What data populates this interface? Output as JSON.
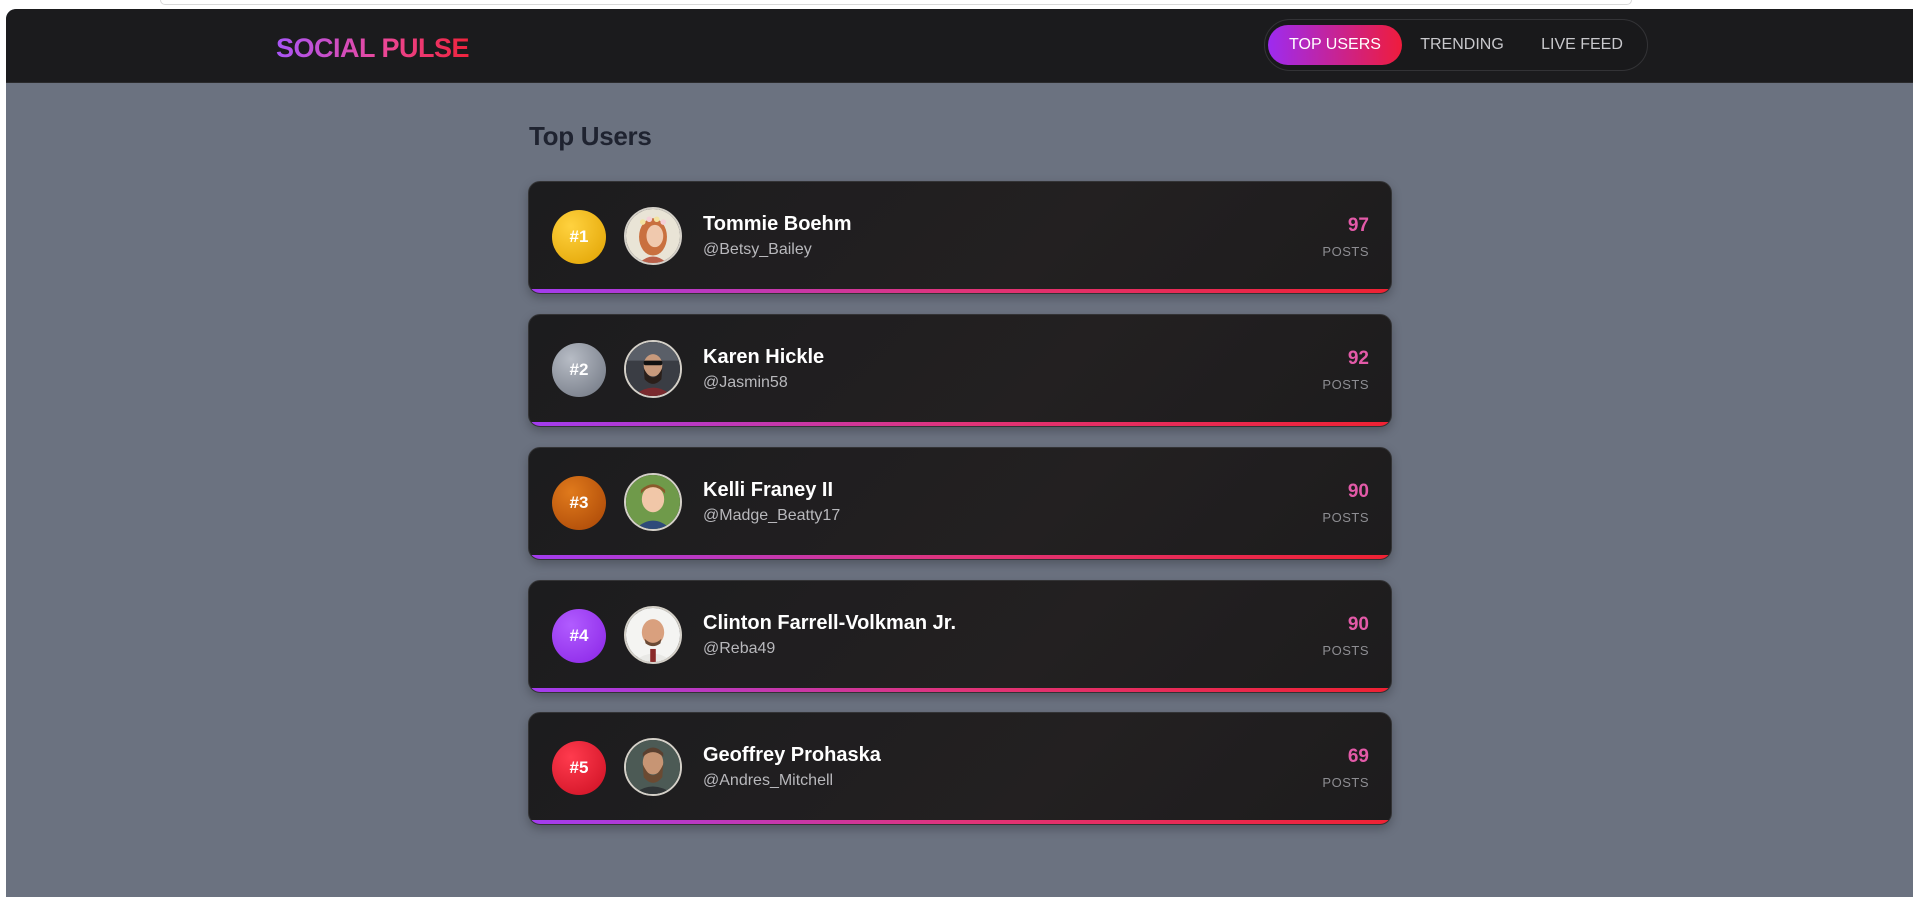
{
  "brand": "SOCIAL PULSE",
  "nav": {
    "tabs": [
      {
        "label": "TOP USERS",
        "active": true
      },
      {
        "label": "TRENDING",
        "active": false
      },
      {
        "label": "LIVE FEED",
        "active": false
      }
    ]
  },
  "page_title": "Top Users",
  "posts_label": "POSTS",
  "users": [
    {
      "rank": "#1",
      "name": "Tommie Boehm",
      "handle": "@Betsy_Bailey",
      "posts": "97",
      "badge_color": "#f0b400"
    },
    {
      "rank": "#2",
      "name": "Karen Hickle",
      "handle": "@Jasmin58",
      "posts": "92",
      "badge_color": "#9aa0aa"
    },
    {
      "rank": "#3",
      "name": "Kelli Franey II",
      "handle": "@Madge_Beatty17",
      "posts": "90",
      "badge_color": "#c2570a"
    },
    {
      "rank": "#4",
      "name": "Clinton Farrell-Volkman Jr.",
      "handle": "@Reba49",
      "posts": "90",
      "badge_color": "#9333ea"
    },
    {
      "rank": "#5",
      "name": "Geoffrey Prohaska",
      "handle": "@Andres_Mitchell",
      "posts": "69",
      "badge_color": "#e11d2e"
    }
  ]
}
